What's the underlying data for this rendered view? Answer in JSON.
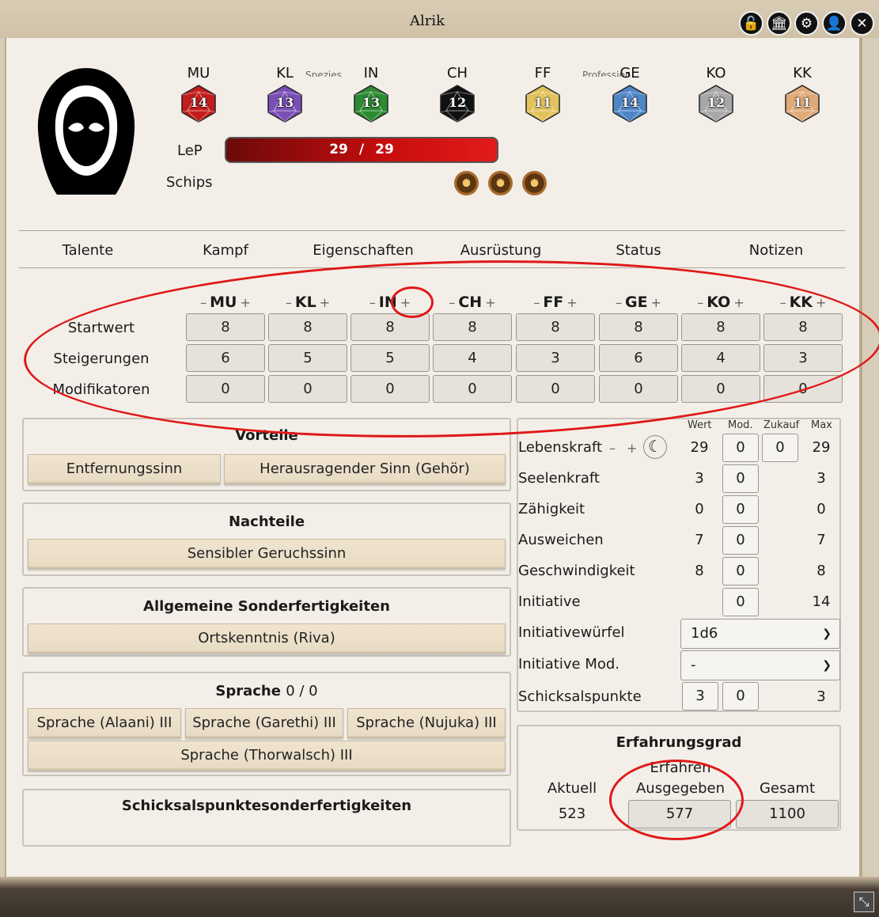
{
  "window": {
    "title": "Alrik",
    "clipped_left": "Spezies",
    "clipped_right": "Profession"
  },
  "attributes": [
    {
      "name": "MU",
      "value": "14",
      "color": "#c21d1d"
    },
    {
      "name": "KL",
      "value": "13",
      "color": "#7a4fb5"
    },
    {
      "name": "IN",
      "value": "13",
      "color": "#2c8a33"
    },
    {
      "name": "CH",
      "value": "12",
      "color": "#111111"
    },
    {
      "name": "FF",
      "value": "11",
      "color": "#e3c25c"
    },
    {
      "name": "GE",
      "value": "14",
      "color": "#4f86c6"
    },
    {
      "name": "KO",
      "value": "12",
      "color": "#a7a7a7"
    },
    {
      "name": "KK",
      "value": "11",
      "color": "#e0aa78"
    }
  ],
  "lep": {
    "label": "LeP",
    "current": "29",
    "sep": "/",
    "max": "29"
  },
  "schips": {
    "label": "Schips",
    "count": 3
  },
  "tabs": [
    "Talente",
    "Kampf",
    "Eigenschaften",
    "Ausrüstung",
    "Status",
    "Notizen"
  ],
  "grid": {
    "minus": "–",
    "plus": "+",
    "rows": [
      {
        "label": "Startwert",
        "values": [
          "8",
          "8",
          "8",
          "8",
          "8",
          "8",
          "8",
          "8"
        ]
      },
      {
        "label": "Steigerungen",
        "values": [
          "6",
          "5",
          "5",
          "4",
          "3",
          "6",
          "4",
          "3"
        ]
      },
      {
        "label": "Modifikatoren",
        "values": [
          "0",
          "0",
          "0",
          "0",
          "0",
          "0",
          "0",
          "0"
        ]
      }
    ]
  },
  "vorteile": {
    "title": "Vorteile",
    "items": [
      "Entfernungssinn",
      "Herausragender Sinn (Gehör)"
    ]
  },
  "nachteile": {
    "title": "Nachteile",
    "items": [
      "Sensibler Geruchssinn"
    ]
  },
  "sonderfertigkeiten": {
    "title": "Allgemeine Sonderfertigkeiten",
    "items": [
      "Ortskenntnis (Riva)"
    ]
  },
  "sprache": {
    "title": "Sprache",
    "count": "0 / 0",
    "items": [
      "Sprache (Alaani) III",
      "Sprache (Garethi) III",
      "Sprache (Nujuka) III",
      "Sprache (Thorwalsch) III"
    ]
  },
  "schicksal_sf": {
    "title": "Schicksalspunktesonderfertigkeiten"
  },
  "derived": {
    "headers": {
      "wert": "Wert",
      "mod": "Mod.",
      "zukauf": "Zukauf",
      "max": "Max"
    },
    "rows": [
      {
        "label": "Lebenskraft",
        "wert": "29",
        "mod": "0",
        "zukauf": "0",
        "max": "29"
      },
      {
        "label": "Seelenkraft",
        "wert": "3",
        "mod": "0",
        "max": "3"
      },
      {
        "label": "Zähigkeit",
        "wert": "0",
        "mod": "0",
        "max": "0"
      },
      {
        "label": "Ausweichen",
        "wert": "7",
        "mod": "0",
        "max": "7"
      },
      {
        "label": "Geschwindigkeit",
        "wert": "8",
        "mod": "0",
        "max": "8"
      },
      {
        "label": "Initiative",
        "mod": "0",
        "max": "14"
      }
    ],
    "initiativewuerfel": {
      "label": "Initiativewürfel",
      "value": "1d6"
    },
    "initiative_mod": {
      "label": "Initiative Mod.",
      "value": "-"
    },
    "schicksalspunkte": {
      "label": "Schicksalspunkte",
      "wert": "3",
      "mod": "0",
      "max": "3"
    }
  },
  "experience": {
    "title": "Erfahrungsgrad",
    "grade": "Erfahren",
    "aktuell_label": "Aktuell",
    "aktuell": "523",
    "ausgegeben_label": "Ausgegeben",
    "ausgegeben": "577",
    "gesamt_label": "Gesamt",
    "gesamt": "1100"
  }
}
